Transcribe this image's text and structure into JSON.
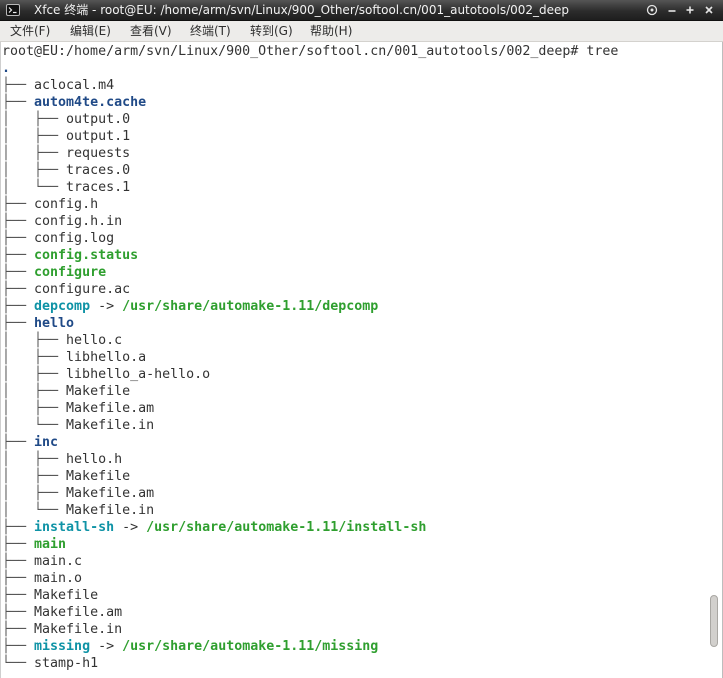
{
  "window": {
    "title": "Xfce 终端 - root@EU: /home/arm/svn/Linux/900_Other/softool.cn/001_autotools/002_deep",
    "app_icon": "terminal-icon",
    "controls": [
      "stick-icon",
      "minimize-icon",
      "maximize-icon",
      "close-icon"
    ]
  },
  "menu": [
    {
      "label": "文件(F)"
    },
    {
      "label": "编辑(E)"
    },
    {
      "label": "查看(V)"
    },
    {
      "label": "终端(T)"
    },
    {
      "label": "转到(G)"
    },
    {
      "label": "帮助(H)"
    }
  ],
  "colors": {
    "text": "#333333",
    "tree": "#555555",
    "directory": "#204a87",
    "executable": "#2f9f2f",
    "symlink": "#0f93a6"
  },
  "terminal": {
    "prompt": "root@EU:/home/arm/svn/Linux/900_Other/softool.cn/001_autotools/002_deep#",
    "command": "tree",
    "scroll_percent": 95,
    "tree": [
      {
        "prefix": "",
        "name": ".",
        "kind": "directory"
      },
      {
        "prefix": "├── ",
        "name": "aclocal.m4",
        "kind": "file"
      },
      {
        "prefix": "├── ",
        "name": "autom4te.cache",
        "kind": "directory"
      },
      {
        "prefix": "│   ├── ",
        "name": "output.0",
        "kind": "file"
      },
      {
        "prefix": "│   ├── ",
        "name": "output.1",
        "kind": "file"
      },
      {
        "prefix": "│   ├── ",
        "name": "requests",
        "kind": "file"
      },
      {
        "prefix": "│   ├── ",
        "name": "traces.0",
        "kind": "file"
      },
      {
        "prefix": "│   └── ",
        "name": "traces.1",
        "kind": "file"
      },
      {
        "prefix": "├── ",
        "name": "config.h",
        "kind": "file"
      },
      {
        "prefix": "├── ",
        "name": "config.h.in",
        "kind": "file"
      },
      {
        "prefix": "├── ",
        "name": "config.log",
        "kind": "file"
      },
      {
        "prefix": "├── ",
        "name": "config.status",
        "kind": "executable"
      },
      {
        "prefix": "├── ",
        "name": "configure",
        "kind": "executable"
      },
      {
        "prefix": "├── ",
        "name": "configure.ac",
        "kind": "file"
      },
      {
        "prefix": "├── ",
        "name": "depcomp",
        "kind": "symlink",
        "arrow": "->",
        "target": "/usr/share/automake-1.11/depcomp",
        "target_kind": "executable"
      },
      {
        "prefix": "├── ",
        "name": "hello",
        "kind": "directory"
      },
      {
        "prefix": "│   ├── ",
        "name": "hello.c",
        "kind": "file"
      },
      {
        "prefix": "│   ├── ",
        "name": "libhello.a",
        "kind": "file"
      },
      {
        "prefix": "│   ├── ",
        "name": "libhello_a-hello.o",
        "kind": "file"
      },
      {
        "prefix": "│   ├── ",
        "name": "Makefile",
        "kind": "file"
      },
      {
        "prefix": "│   ├── ",
        "name": "Makefile.am",
        "kind": "file"
      },
      {
        "prefix": "│   └── ",
        "name": "Makefile.in",
        "kind": "file"
      },
      {
        "prefix": "├── ",
        "name": "inc",
        "kind": "directory"
      },
      {
        "prefix": "│   ├── ",
        "name": "hello.h",
        "kind": "file"
      },
      {
        "prefix": "│   ├── ",
        "name": "Makefile",
        "kind": "file"
      },
      {
        "prefix": "│   ├── ",
        "name": "Makefile.am",
        "kind": "file"
      },
      {
        "prefix": "│   └── ",
        "name": "Makefile.in",
        "kind": "file"
      },
      {
        "prefix": "├── ",
        "name": "install-sh",
        "kind": "symlink",
        "arrow": "->",
        "target": "/usr/share/automake-1.11/install-sh",
        "target_kind": "executable"
      },
      {
        "prefix": "├── ",
        "name": "main",
        "kind": "executable"
      },
      {
        "prefix": "├── ",
        "name": "main.c",
        "kind": "file"
      },
      {
        "prefix": "├── ",
        "name": "main.o",
        "kind": "file"
      },
      {
        "prefix": "├── ",
        "name": "Makefile",
        "kind": "file"
      },
      {
        "prefix": "├── ",
        "name": "Makefile.am",
        "kind": "file"
      },
      {
        "prefix": "├── ",
        "name": "Makefile.in",
        "kind": "file"
      },
      {
        "prefix": "├── ",
        "name": "missing",
        "kind": "symlink",
        "arrow": "->",
        "target": "/usr/share/automake-1.11/missing",
        "target_kind": "executable"
      },
      {
        "prefix": "└── ",
        "name": "stamp-h1",
        "kind": "file"
      }
    ]
  }
}
